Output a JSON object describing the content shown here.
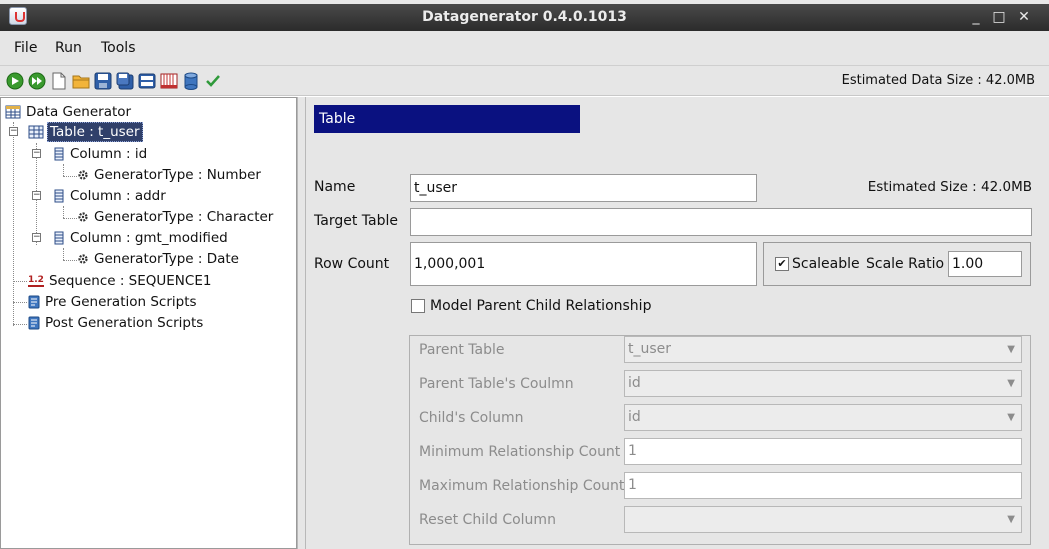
{
  "window": {
    "title": "Datagenerator 0.4.0.1013",
    "minimize_glyph": "_",
    "maximize_glyph": "□",
    "close_glyph": "✕"
  },
  "menu": {
    "file": "File",
    "run": "Run",
    "tools": "Tools"
  },
  "toolbar": {
    "icons": [
      "run-icon",
      "run-all-icon",
      "new-icon",
      "open-folder-icon",
      "save-icon",
      "save-as-icon",
      "save-all-icon",
      "table-chart-icon",
      "database-icon",
      "validate-check-icon"
    ],
    "estimated_data_size": "Estimated Data Size : 42.0MB"
  },
  "tree": {
    "root": "Data Generator",
    "table": "Table : t_user",
    "col_id": "Column : id",
    "gen_number": "GeneratorType : Number",
    "col_addr": "Column : addr",
    "gen_character": "GeneratorType : Character",
    "col_gmt": "Column : gmt_modified",
    "gen_date": "GeneratorType : Date",
    "sequence": "Sequence : SEQUENCE1",
    "sequence_icon_text": "1.2",
    "pre_scripts": "Pre Generation Scripts",
    "post_scripts": "Post Generation Scripts"
  },
  "form": {
    "header": "Table",
    "name_label": "Name",
    "name_value": "t_user",
    "estimated_size": "Estimated Size :  42.0MB",
    "target_table_label": "Target Table",
    "target_table_value": "",
    "row_count_label": "Row Count",
    "row_count_value": "1,000,001",
    "scaleable_label": "Scaleable",
    "scaleable_checked": true,
    "scale_ratio_label": "Scale Ratio",
    "scale_ratio_value": "1.00",
    "model_parent_child_label": "Model Parent Child Relationship",
    "model_parent_child_checked": false
  },
  "relationship": {
    "parent_table_label": "Parent Table",
    "parent_table_value": "t_user",
    "parent_column_label": "Parent Table's Coulmn",
    "parent_column_value": "id",
    "child_column_label": "Child's Column",
    "child_column_value": "id",
    "min_count_label": "Minimum Relationship Count",
    "min_count_value": "1",
    "max_count_label": "Maximum Relationship Count",
    "max_count_value": "1",
    "reset_child_label": "Reset Child Column",
    "reset_child_value": ""
  },
  "colors": {
    "header_bg": "#0a1180",
    "selection_bg": "#30406a",
    "titlebar_bg": "#333333",
    "panel_bg": "#e6e6e6"
  }
}
